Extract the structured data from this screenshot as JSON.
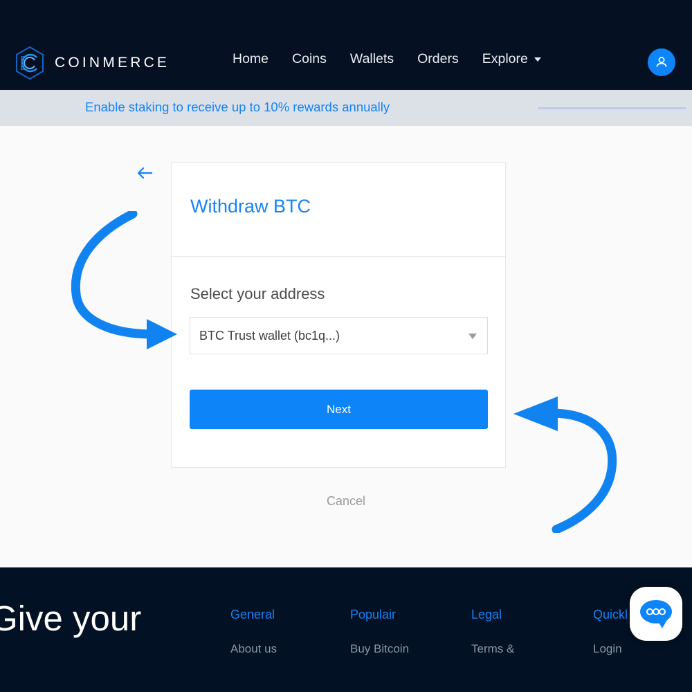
{
  "header": {
    "brand_name": "COINMERCE",
    "brand_icon": "coinmerce-hexagon-logo",
    "nav": [
      {
        "label": "Home"
      },
      {
        "label": "Coins"
      },
      {
        "label": "Wallets"
      },
      {
        "label": "Orders"
      },
      {
        "label": "Explore"
      }
    ],
    "explore_caret_icon": "chevron-down-icon",
    "account_icon": "user-avatar-icon",
    "background_color": "#061023"
  },
  "banner": {
    "text": "Enable staking to receive up to 10% rewards annually",
    "text_color": "#1683F5",
    "background_color": "#DCE1E8",
    "rule_color": "#B9CDE4"
  },
  "main": {
    "back_icon": "arrow-left-icon",
    "card": {
      "title": "Withdraw BTC",
      "title_color": "#1683F5",
      "field_label": "Select your address",
      "select_value": "BTC Trust wallet (bc1q...)",
      "select_caret_icon": "triangle-down-icon",
      "next_label": "Next",
      "next_color": "#0D85F8"
    },
    "cancel_label": "Cancel",
    "annotations": {
      "left_arrow_icon": "curved-arrow-right-icon",
      "right_arrow_icon": "curved-arrow-left-icon",
      "arrow_color": "#1183F0"
    }
  },
  "footer": {
    "heading": "Give your",
    "subheading": "",
    "background_color": "#031124",
    "columns": [
      {
        "title": "General",
        "link": "About us"
      },
      {
        "title": "Populair",
        "link": "Buy Bitcoin"
      },
      {
        "title": "Legal",
        "link": "Terms &"
      },
      {
        "title": "Quickl",
        "link": "Login"
      }
    ]
  },
  "chat": {
    "icon": "chat-bubble-icon",
    "bubble_color": "#0D85F8"
  }
}
